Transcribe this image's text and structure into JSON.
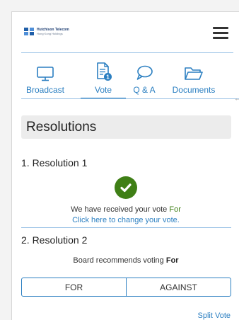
{
  "header": {
    "logo_line1": "Hutchison Telecom",
    "logo_line2": "Hong Kong Holdings",
    "menu_icon": "hamburger-icon"
  },
  "tabs": [
    {
      "label": "Broadcast",
      "icon": "monitor-icon"
    },
    {
      "label": "Vote",
      "icon": "document-icon",
      "badge": "1",
      "active": true
    },
    {
      "label": "Q & A",
      "icon": "speech-bubble-icon"
    },
    {
      "label": "Documents",
      "icon": "folder-icon"
    }
  ],
  "section_title": "Resolutions",
  "resolutions": [
    {
      "title": "1. Resolution 1",
      "status_icon": "check-circle-icon",
      "received_text": "We have received your vote",
      "vote_value": "For",
      "change_link": "Click here to change your vote."
    },
    {
      "title": "2. Resolution 2",
      "recommend_text": "Board recommends voting",
      "recommend_value": "For",
      "options": [
        "FOR",
        "AGAINST"
      ],
      "split_vote": "Split Vote"
    }
  ],
  "colors": {
    "accent": "#2b7fc1",
    "success": "#3f7f16",
    "header_bg": "#ececec",
    "divider": "#9cc3e6"
  }
}
